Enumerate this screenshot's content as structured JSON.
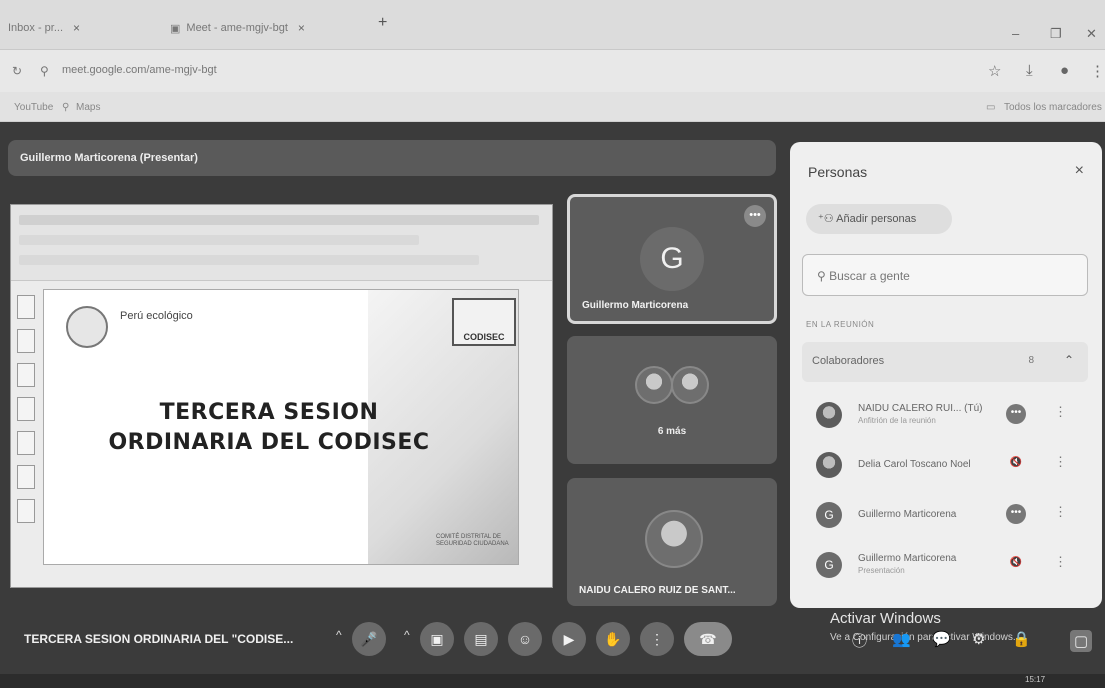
{
  "browser": {
    "tabs": [
      {
        "label": "Inbox - pr...",
        "close": "× "
      },
      {
        "label": "Meet - ame-mgjv-bgt",
        "close": "×"
      }
    ],
    "new_tab": "+",
    "url": "meet.google.com/ame-mgjv-bgt",
    "bookmarks": [
      {
        "label": "YouTube"
      },
      {
        "label": "Maps"
      }
    ],
    "all_bookmarks": "Todos los marcadores"
  },
  "meet": {
    "presenter_label": "Guillermo Marticorena (Presentar)",
    "slide": {
      "title": "TERCERA SESION ORDINARIA DEL CODISEC",
      "brand": "Perú ecológico",
      "badge": "CODISEC",
      "footnote": "COMITÉ DISTRITAL DE SEGURIDAD CIUDADANA"
    },
    "tiles": [
      {
        "initial": "G",
        "name": "Guillermo Marticorena",
        "more": "•••"
      },
      {
        "name": "6 más"
      },
      {
        "name": "NAIDU CALERO RUIZ DE SANT..."
      }
    ],
    "meeting_title": "TERCERA SESION ORDINARIA DEL \"CODISE...",
    "controls": [
      "^",
      "🎤",
      "^",
      "▣",
      "▤",
      "☺",
      "▶",
      "✋",
      "⋮",
      "☎"
    ],
    "right_controls": [
      "ⓘ",
      "👥",
      "💬",
      "⚙",
      "🔒",
      "▢"
    ],
    "windows_activate": "Activar Windows",
    "windows_activate_sub": "Ve a Configuración para activar Windows."
  },
  "people_panel": {
    "title": "Personas",
    "close": "×",
    "add_people": "Añadir personas",
    "search_placeholder": "Buscar a gente",
    "section_label": "EN LA REUNIÓN",
    "group": {
      "label": "Colaboradores",
      "count": "8"
    },
    "participants": [
      {
        "name": "NAIDU CALERO RUI... (Tú)",
        "role": "Anfitrión de la reunión",
        "status": "•••"
      },
      {
        "name": "Delia Carol Toscano Noel",
        "role": "",
        "status": "🔇"
      },
      {
        "name": "Guillermo Marticorena",
        "role": "",
        "status": "•••",
        "initial": "G"
      },
      {
        "name": "Guillermo Marticorena",
        "role": "Presentación",
        "status": "🔇",
        "initial": "G"
      }
    ]
  },
  "taskbar": {
    "clock": "15:17"
  }
}
